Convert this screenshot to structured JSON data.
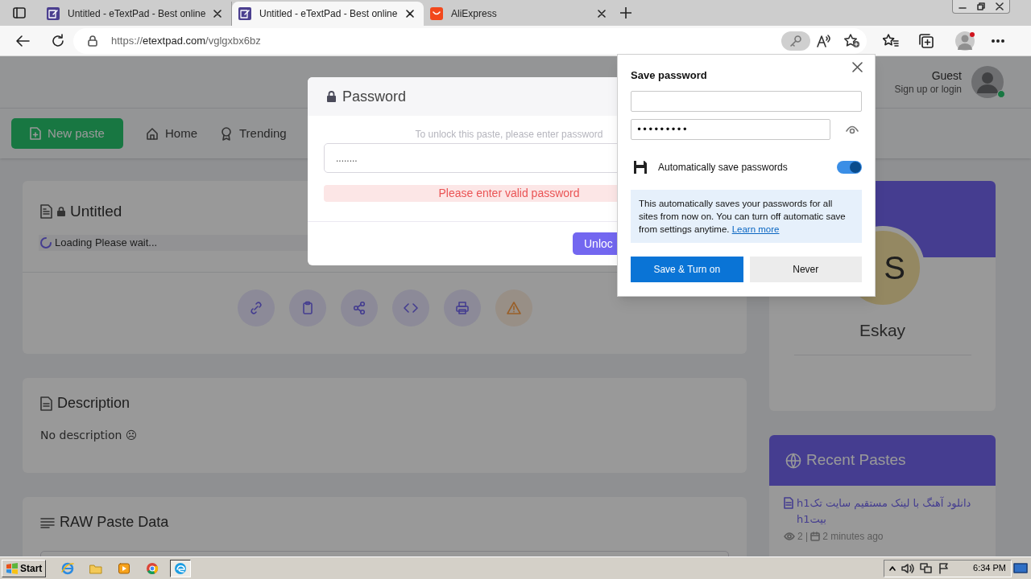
{
  "browser": {
    "tabs": [
      {
        "title": "Untitled - eTextPad - Best online",
        "kind": "doc",
        "selected": false
      },
      {
        "title": "Untitled - eTextPad - Best online",
        "kind": "doc",
        "selected": true
      },
      {
        "title": "AliExpress",
        "kind": "shop",
        "selected": false
      }
    ],
    "url": {
      "scheme": "https://",
      "domain": "etextpad.com",
      "path": "/vglgxbx6bz"
    }
  },
  "page": {
    "nav": {
      "new_paste": "New paste",
      "links": [
        "Home",
        "Trending"
      ]
    },
    "user": {
      "name": "Guest",
      "subtitle": "Sign up or login",
      "online": true
    },
    "paste": {
      "title": "Untitled",
      "locked": true,
      "loading": "Loading Please wait..."
    },
    "description": {
      "heading": "Description",
      "text": "No description ☹"
    },
    "raw": {
      "heading": "RAW Paste Data"
    },
    "author": {
      "initials": "S",
      "name": "Eskay"
    },
    "recent": {
      "heading": "Recent Pastes",
      "items": [
        {
          "title": "h1دانلود آهنگ با لینک مستقیم سایت تک h1بیت",
          "views": "2 |",
          "time": "2 minutes ago"
        }
      ]
    }
  },
  "modal": {
    "title": "Password",
    "hint": "To unlock this paste, please enter password",
    "value": "........",
    "error": "Please enter valid password",
    "button": "Unloc"
  },
  "popup": {
    "title": "Save password",
    "password": "•••••••••",
    "auto_save": {
      "label": "Automatically save passwords",
      "on": true
    },
    "info": "This automatically saves your passwords for all sites from now on. You can turn off automatic save from settings anytime.",
    "link": "Learn more",
    "buttons": [
      "Save & Turn on",
      "Never"
    ]
  },
  "taskbar": {
    "start": "Start",
    "apps": [
      {
        "kind": "ie",
        "selected": false
      },
      {
        "kind": "folder",
        "selected": false
      },
      {
        "kind": "media",
        "selected": false
      },
      {
        "kind": "chrome",
        "selected": false
      },
      {
        "kind": "edge",
        "selected": true
      }
    ],
    "clock": "6:34 PM"
  }
}
